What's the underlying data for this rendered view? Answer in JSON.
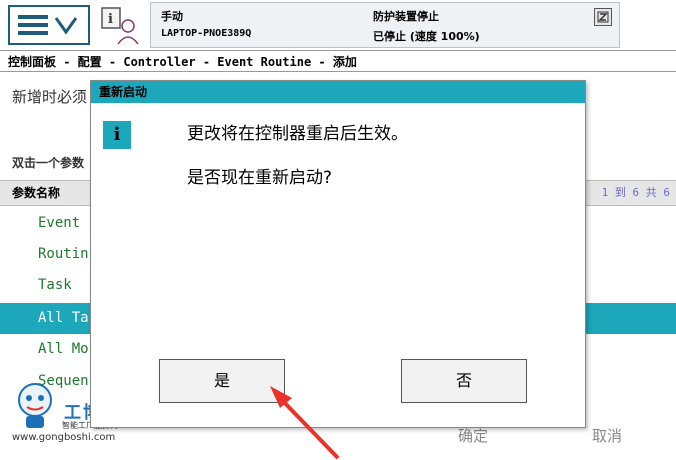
{
  "status": {
    "mode": "手动",
    "host": "LAPTOP-PNOE389Q",
    "guard": "防护装置停止",
    "state": "已停止 (速度 100%)"
  },
  "breadcrumb": "控制面板 - 配置 - Controller - Event Routine - 添加",
  "page": {
    "description": "新增时必须",
    "hint": "双击一个参数"
  },
  "table": {
    "header": "参数名称",
    "count": "1 到 6 共 6",
    "rows": [
      "Event",
      "Routin",
      "Task",
      "All Ta",
      "All Mo",
      "Sequen"
    ]
  },
  "bottom": {
    "ok": "确定",
    "cancel": "取消"
  },
  "logo": {
    "brand": "工博士",
    "tagline": "智能工厂服务商",
    "url": "www.gongboshi.com"
  },
  "dialog": {
    "title": "重新启动",
    "message1": "更改将在控制器重启后生效。",
    "message2": "是否现在重新启动?",
    "yes": "是",
    "no": "否"
  },
  "colors": {
    "accent": "#1da7ba",
    "row_text": "#1d7a2a",
    "annotation_arrow": "#e8322a"
  }
}
